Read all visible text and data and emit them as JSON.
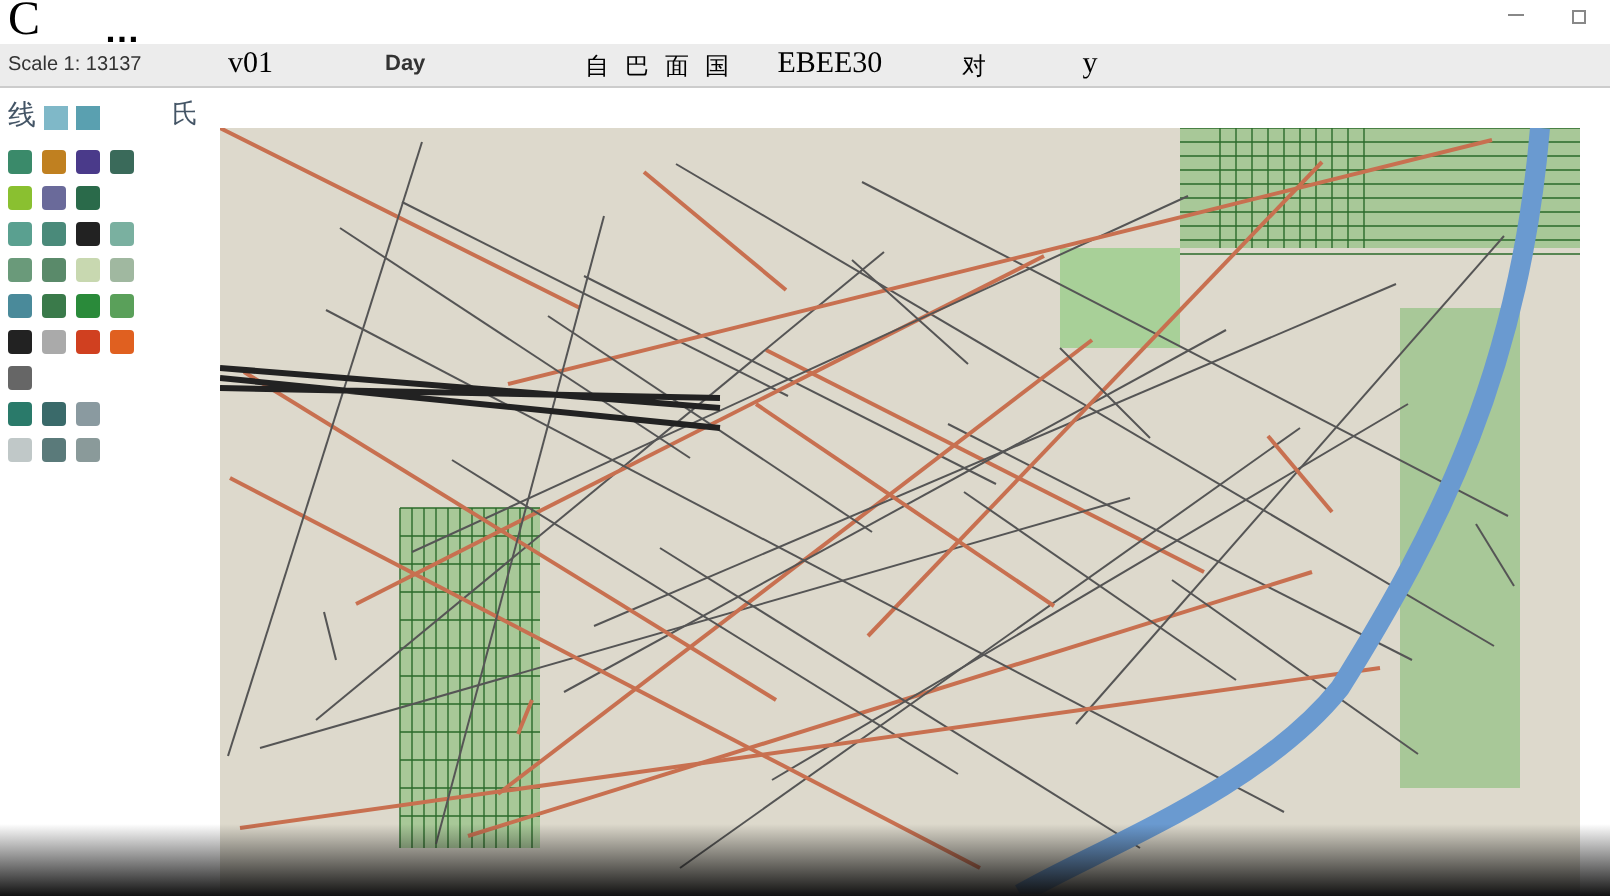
{
  "window": {
    "title": "C",
    "title_suffix": "…"
  },
  "toolbar": {
    "scale": "Scale 1: 13137",
    "items": [
      {
        "text": "v01",
        "kind": "serif"
      },
      {
        "text": "Day",
        "kind": "bold"
      },
      {
        "text": "自",
        "kind": "cjk"
      },
      {
        "text": "巴",
        "kind": "cjk"
      },
      {
        "text": "面",
        "kind": "cjk"
      },
      {
        "text": "国",
        "kind": "cjk"
      },
      {
        "text": "EBEE30",
        "kind": "serif"
      },
      {
        "text": "对",
        "kind": "cjk"
      },
      {
        "text": "y",
        "kind": "serif"
      }
    ]
  },
  "palette": {
    "header": "线",
    "side_label": "氏"
  }
}
